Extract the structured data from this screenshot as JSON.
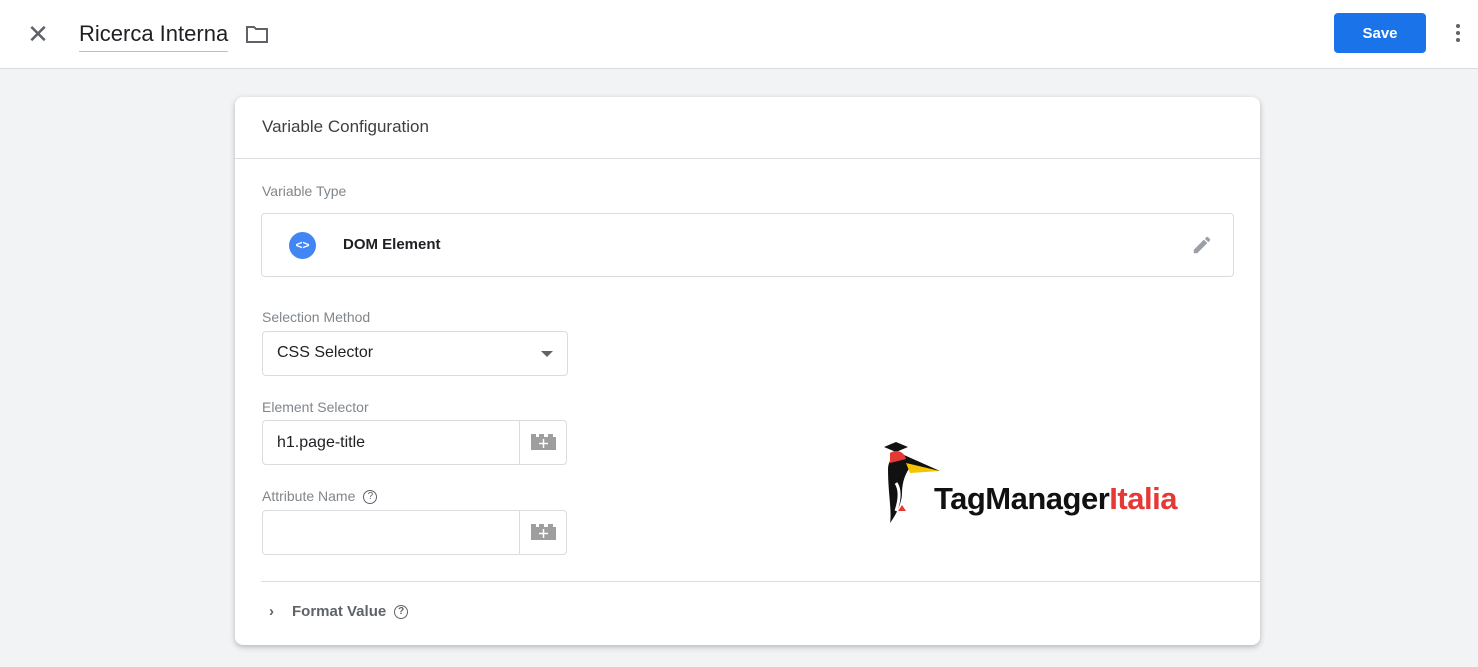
{
  "header": {
    "title": "Ricerca Interna",
    "save_label": "Save"
  },
  "card": {
    "title": "Variable Configuration",
    "variable_type_label": "Variable Type",
    "variable_type": "DOM Element",
    "variable_type_icon": "<>",
    "selection_method_label": "Selection Method",
    "selection_method": "CSS Selector",
    "element_selector_label": "Element Selector",
    "element_selector": "h1.page-title",
    "attribute_name_label": "Attribute Name",
    "attribute_name": "",
    "format_value_label": "Format Value",
    "help_glyph": "?"
  },
  "logo": {
    "text_black": "TagManager",
    "text_red": "Italia"
  },
  "colors": {
    "accent": "#1a73e8",
    "type_icon": "#4285f4",
    "logo_red": "#e53935"
  }
}
